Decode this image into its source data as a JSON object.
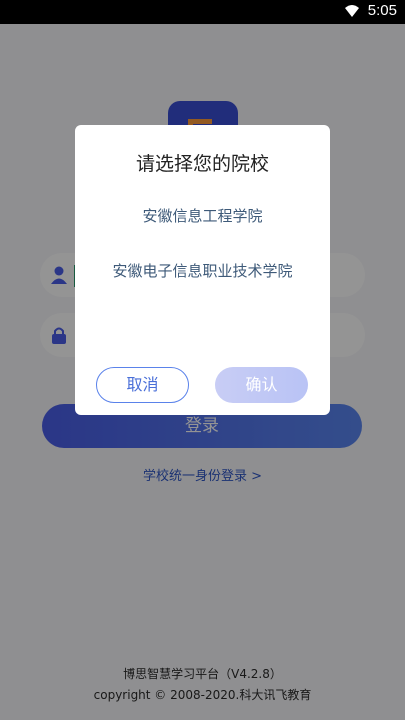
{
  "status_bar": {
    "time": "5:05",
    "wifi_icon": "wifi-icon"
  },
  "login": {
    "logo_icon": "app-logo",
    "username_icon": "user-icon",
    "password_icon": "lock-icon",
    "login_button": "登录",
    "sso_link": "学校统一身份登录 >"
  },
  "dialog": {
    "title": "请选择您的院校",
    "options": [
      "安徽信息工程学院",
      "安徽电子信息职业技术学院"
    ],
    "cancel": "取消",
    "confirm": "确认"
  },
  "footer": {
    "app_version": "博思智慧学习平台（V4.2.8）",
    "copyright": "copyright © 2008-2020.科大讯飞教育"
  },
  "colors": {
    "accent": "#4a5ee8",
    "link": "#2f56c6"
  }
}
